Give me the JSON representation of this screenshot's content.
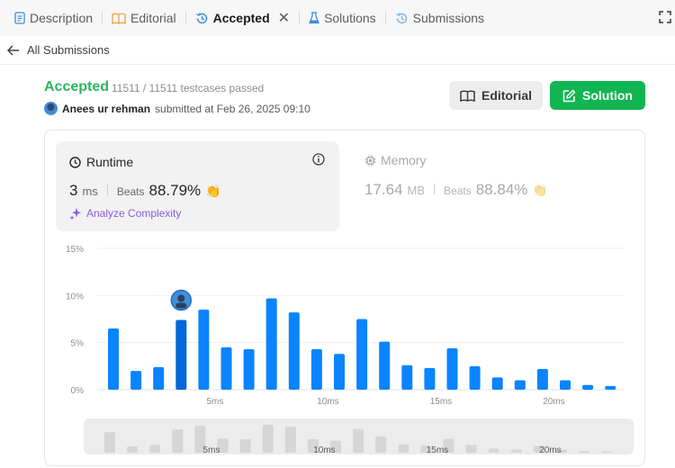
{
  "tabs": [
    {
      "label": "Description",
      "icon": "description-icon",
      "active": false
    },
    {
      "label": "Editorial",
      "icon": "book-icon",
      "active": false
    },
    {
      "label": "Accepted",
      "icon": "history-icon",
      "active": true
    },
    {
      "label": "Solutions",
      "icon": "flask-icon",
      "active": false
    },
    {
      "label": "Submissions",
      "icon": "history-icon",
      "active": false
    }
  ],
  "back": {
    "label": "All Submissions"
  },
  "submission": {
    "status": "Accepted",
    "testcases": "11511 / 11511 testcases passed",
    "username": "Anees ur rehman",
    "submitted_text": "submitted at Feb 26, 2025 09:10"
  },
  "buttons": {
    "editorial": "Editorial",
    "solution": "Solution"
  },
  "runtime": {
    "title": "Runtime",
    "value": "3",
    "unit": "ms",
    "beats_label": "Beats",
    "beats_pct": "88.79%",
    "analyze": "Analyze Complexity"
  },
  "memory": {
    "title": "Memory",
    "value": "17.64",
    "unit": "MB",
    "beats_label": "Beats",
    "beats_pct": "88.84%"
  },
  "colors": {
    "accent": "#0a84ff",
    "accepted": "#2cb55d",
    "solution_btn": "#11b551",
    "highlight_bar": "#0066d9"
  },
  "chart_data": {
    "type": "bar",
    "ylim": [
      0,
      15
    ],
    "yticks": [
      "15%",
      "10%",
      "5%",
      "0%"
    ],
    "ytick_values": [
      15,
      10,
      5,
      0
    ],
    "x_tick_labels": [
      "5ms",
      "10ms",
      "15ms",
      "20ms"
    ],
    "x_tick_after_bar": [
      5,
      10,
      15,
      20
    ],
    "values": [
      6.5,
      2.0,
      2.4,
      7.4,
      8.5,
      4.5,
      4.3,
      9.7,
      8.2,
      4.3,
      3.8,
      7.5,
      5.1,
      2.6,
      2.3,
      4.4,
      2.5,
      1.3,
      1.0,
      2.2,
      1.0,
      0.5,
      0.4
    ],
    "highlight_index": 3,
    "grid": true,
    "minimap": {
      "x_tick_labels": [
        "5ms",
        "10ms",
        "15ms",
        "20ms"
      ]
    }
  }
}
